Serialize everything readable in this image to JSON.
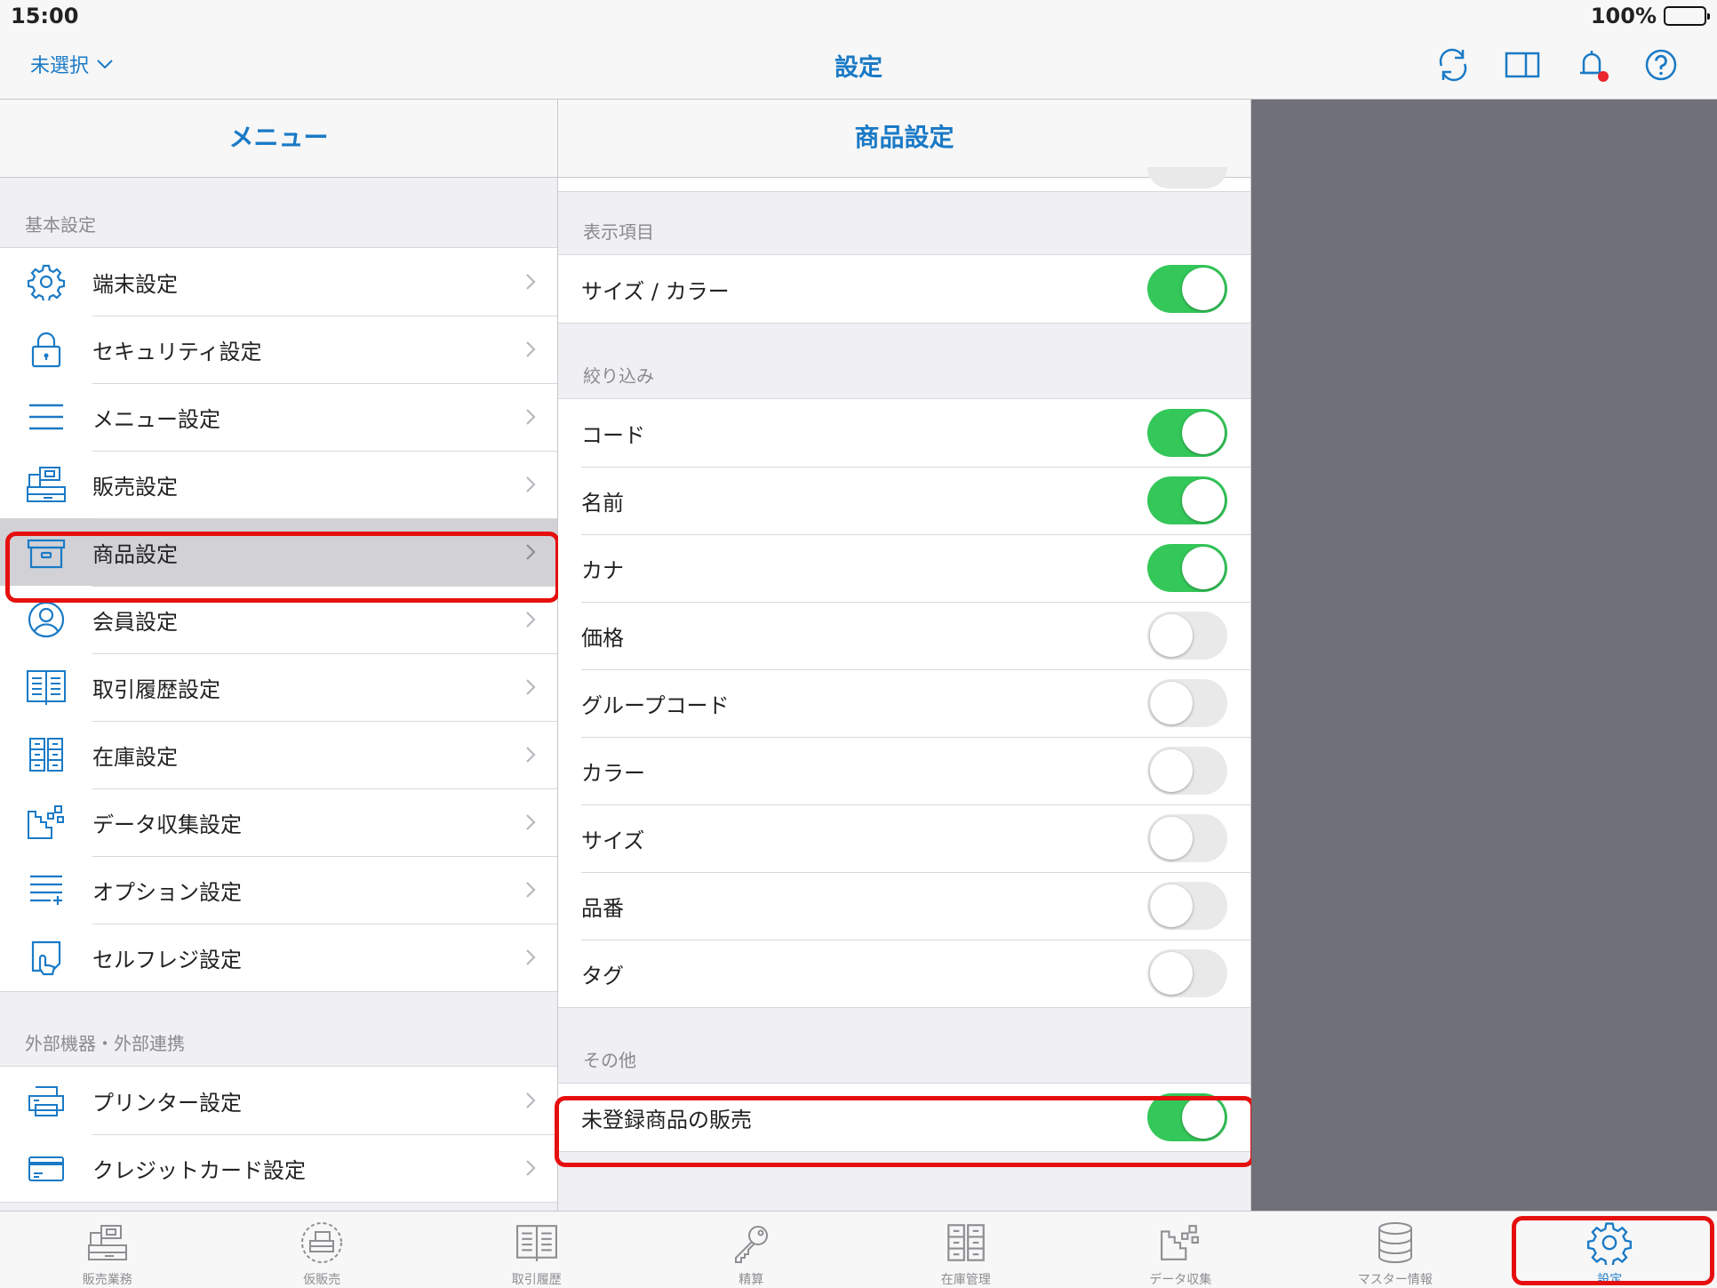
{
  "status_bar": {
    "time": "15:00",
    "battery": "100%"
  },
  "nav": {
    "left_label": "未選択",
    "title": "設定"
  },
  "menu": {
    "title": "メニュー",
    "sections": [
      {
        "label": "基本設定",
        "items": [
          {
            "label": "端末設定",
            "icon": "gear-icon"
          },
          {
            "label": "セキュリティ設定",
            "icon": "lock-icon"
          },
          {
            "label": "メニュー設定",
            "icon": "menu-lines-icon"
          },
          {
            "label": "販売設定",
            "icon": "register-icon"
          },
          {
            "label": "商品設定",
            "icon": "box-icon",
            "selected": true
          },
          {
            "label": "会員設定",
            "icon": "person-icon"
          },
          {
            "label": "取引履歴設定",
            "icon": "book-icon"
          },
          {
            "label": "在庫設定",
            "icon": "cabinet-icon"
          },
          {
            "label": "データ収集設定",
            "icon": "data-collection-icon"
          },
          {
            "label": "オプション設定",
            "icon": "option-list-icon"
          },
          {
            "label": "セルフレジ設定",
            "icon": "self-register-icon"
          }
        ]
      },
      {
        "label": "外部機器・外部連携",
        "items": [
          {
            "label": "プリンター設定",
            "icon": "printer-icon"
          },
          {
            "label": "クレジットカード設定",
            "icon": "credit-card-icon"
          }
        ]
      }
    ]
  },
  "product_settings": {
    "title": "商品設定",
    "sections": [
      {
        "label": "表示項目",
        "items": [
          {
            "label": "サイズ / カラー",
            "on": true
          }
        ]
      },
      {
        "label": "絞り込み",
        "items": [
          {
            "label": "コード",
            "on": true
          },
          {
            "label": "名前",
            "on": true
          },
          {
            "label": "カナ",
            "on": true
          },
          {
            "label": "価格",
            "on": false
          },
          {
            "label": "グループコード",
            "on": false
          },
          {
            "label": "カラー",
            "on": false
          },
          {
            "label": "サイズ",
            "on": false
          },
          {
            "label": "品番",
            "on": false
          },
          {
            "label": "タグ",
            "on": false
          }
        ]
      },
      {
        "label": "その他",
        "items": [
          {
            "label": "未登録商品の販売",
            "on": true
          }
        ]
      }
    ]
  },
  "tabs": [
    {
      "label": "販売業務",
      "icon": "register-icon"
    },
    {
      "label": "仮販売",
      "icon": "temp-sale-icon"
    },
    {
      "label": "取引履歴",
      "icon": "book-icon"
    },
    {
      "label": "精算",
      "icon": "key-icon"
    },
    {
      "label": "在庫管理",
      "icon": "cabinet-icon"
    },
    {
      "label": "データ収集",
      "icon": "data-collection-icon"
    },
    {
      "label": "マスター情報",
      "icon": "database-icon"
    },
    {
      "label": "設定",
      "icon": "gear-icon",
      "active": true
    }
  ],
  "colors": {
    "accent": "#1a7ac6",
    "switch_on": "#34c759",
    "highlight": "#e60f0f",
    "detail_bg": "#707078"
  }
}
